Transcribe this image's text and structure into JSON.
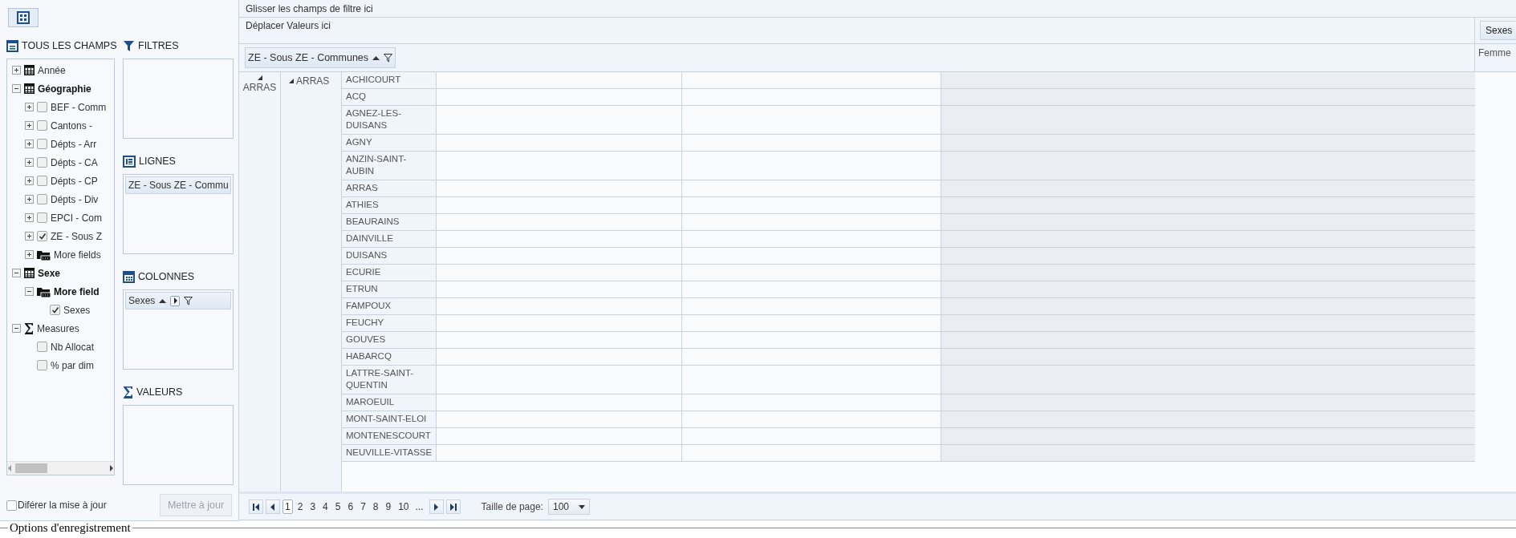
{
  "field_list": {
    "title": "TOUS LES CHAMPS",
    "tree": [
      {
        "label": "Année",
        "kind": "dimension",
        "expanded": false,
        "bold": false
      },
      {
        "label": "Géographie",
        "kind": "dimension",
        "expanded": true,
        "bold": true,
        "children": [
          {
            "label": "BEF - Comm",
            "kind": "hierarchy",
            "expanded": false,
            "checked": false
          },
          {
            "label": "Cantons -",
            "kind": "hierarchy",
            "expanded": false,
            "checked": false
          },
          {
            "label": "Dépts - Arr",
            "kind": "hierarchy",
            "expanded": false,
            "checked": false
          },
          {
            "label": "Dépts - CA",
            "kind": "hierarchy",
            "expanded": false,
            "checked": false
          },
          {
            "label": "Dépts - CP",
            "kind": "hierarchy",
            "expanded": false,
            "checked": false
          },
          {
            "label": "Dépts - Div",
            "kind": "hierarchy",
            "expanded": false,
            "checked": false
          },
          {
            "label": "EPCI - Com",
            "kind": "hierarchy",
            "expanded": false,
            "checked": false
          },
          {
            "label": "ZE - Sous Z",
            "kind": "hierarchy",
            "expanded": false,
            "checked": true
          },
          {
            "label": "More fields",
            "kind": "folder",
            "expanded": false,
            "bold": false
          }
        ]
      },
      {
        "label": "Sexe",
        "kind": "dimension",
        "expanded": true,
        "bold": true,
        "children": [
          {
            "label": "More field",
            "kind": "folder",
            "expanded": true,
            "bold": true,
            "children": [
              {
                "label": "Sexes",
                "kind": "field",
                "checked": true
              }
            ]
          }
        ]
      },
      {
        "label": "Measures",
        "kind": "measures",
        "expanded": true,
        "bold": false,
        "children": [
          {
            "label": "Nb Allocat",
            "kind": "field",
            "checked": false
          },
          {
            "label": "% par dim",
            "kind": "field",
            "checked": false
          }
        ]
      }
    ]
  },
  "areas": [
    {
      "kind": "filters",
      "title": "FILTRES"
    },
    {
      "kind": "rows",
      "title": "LIGNES",
      "items": [
        {
          "label": "ZE - Sous ZE - Commu"
        }
      ]
    },
    {
      "kind": "columns",
      "title": "COLONNES",
      "items": [
        {
          "label": "Sexes"
        }
      ]
    },
    {
      "kind": "values",
      "title": "VALEURS"
    }
  ],
  "defer_update": {
    "label": "Diférer la mise à jour",
    "checked": false
  },
  "update_button": {
    "label": "Mettre à jour",
    "disabled": true
  },
  "pivot": {
    "filter_zone": "Glisser les champs de filtre ici",
    "data_zone": "Déplacer Valeurs ici",
    "row_field": "ZE - Sous ZE - Communes",
    "column_field": "Sexes",
    "column_headers": [
      "Femme"
    ],
    "row_level_1": "ARRAS",
    "row_level_2": "ARRAS",
    "rows": [
      "ACHICOURT",
      "ACQ",
      "AGNEZ-LES-DUISANS",
      "AGNY",
      "ANZIN-SAINT-AUBIN",
      "ARRAS",
      "ATHIES",
      "BEAURAINS",
      "DAINVILLE",
      "DUISANS",
      "ECURIE",
      "ETRUN",
      "FAMPOUX",
      "FEUCHY",
      "GOUVES",
      "HABARCQ",
      "LATTRE-SAINT-QUENTIN",
      "MAROEUIL",
      "MONT-SAINT-ELOI",
      "MONTENESCOURT",
      "NEUVILLE-VITASSE"
    ]
  },
  "pager": {
    "pages": [
      {
        "label": "1",
        "selected": true
      },
      {
        "label": "2",
        "selected": false
      },
      {
        "label": "3",
        "selected": false
      },
      {
        "label": "4",
        "selected": false
      },
      {
        "label": "5",
        "selected": false
      },
      {
        "label": "6",
        "selected": false
      },
      {
        "label": "7",
        "selected": false
      },
      {
        "label": "8",
        "selected": false
      },
      {
        "label": "9",
        "selected": false
      },
      {
        "label": "10",
        "selected": false
      }
    ],
    "ellipsis": "...",
    "page_size_label": "Taille de page:",
    "page_size": "100"
  },
  "section_legend": "Options d'enregistrement"
}
